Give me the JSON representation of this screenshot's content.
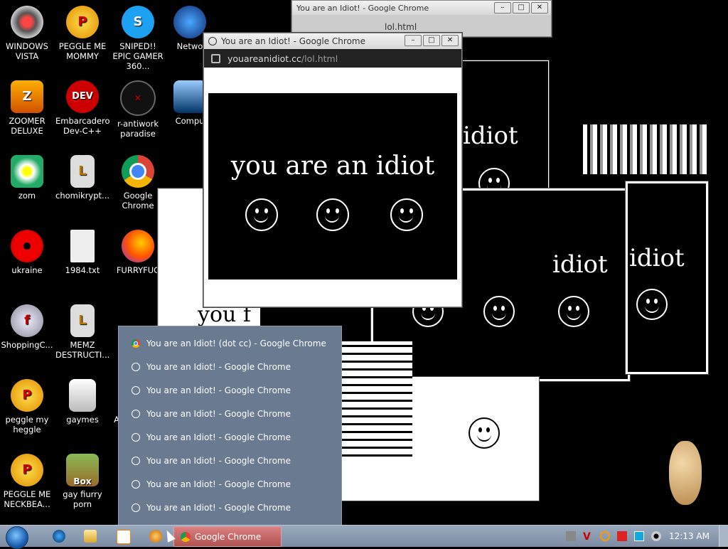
{
  "desktop_icons": [
    {
      "label": "WINDOWS VISTA",
      "icon": "vista-icon"
    },
    {
      "label": "PEGGLE ME MOMMY",
      "icon": "peggle-icon"
    },
    {
      "label": "SNIPED!! EPIC GAMER 360...",
      "icon": "skype-icon"
    },
    {
      "label": "Netwo",
      "icon": "network-icon"
    },
    {
      "label": "ZOOMER DELUXE",
      "icon": "zoomer-icon"
    },
    {
      "label": "Embarcadero Dev-C++",
      "icon": "devcpp-icon"
    },
    {
      "label": "r-antiwork paradise",
      "icon": "antiwork-icon"
    },
    {
      "label": "Compu",
      "icon": "computer-icon"
    },
    {
      "label": "zom",
      "icon": "flower-icon"
    },
    {
      "label": "chomikrypt...",
      "icon": "shortcut-icon"
    },
    {
      "label": "Google Chrome",
      "icon": "chrome-icon"
    },
    {
      "label": "ukraine",
      "icon": "radiation-icon"
    },
    {
      "label": "1984.txt",
      "icon": "text-file-icon"
    },
    {
      "label": "FURRYFUC",
      "icon": "firefox-icon"
    },
    {
      "label": "ShoppingC...",
      "icon": "flash-icon"
    },
    {
      "label": "MEMZ DESTRUCTI...",
      "icon": "shortcut-icon"
    },
    {
      "label": "peggle my heggle",
      "icon": "peggle-icon"
    },
    {
      "label": "gaymes",
      "icon": "folder-icon"
    },
    {
      "label": "A",
      "icon": "generic-icon"
    },
    {
      "label": "PEGGLE ME NECKBEA...",
      "icon": "peggle-icon"
    },
    {
      "label": "gay fiurry porn",
      "icon": "box-icon"
    }
  ],
  "main_window": {
    "title": "You are an Idiot! - Google Chrome",
    "url_host": "youareanidiot.cc",
    "url_path": "/lol.html",
    "message": "you are an idiot"
  },
  "back_windows": {
    "title_1": "You are an Idiot! - Google Chrome",
    "url_fragment": "lol.html",
    "message_fragment": "idiot",
    "message_fragment_2": "you f"
  },
  "jump_list": {
    "items": [
      {
        "label": "You are an Idiot! (dot cc) - Google Chrome",
        "icon": "chrome-icon"
      },
      {
        "label": "You are an Idiot! - Google Chrome",
        "icon": "smiley-icon"
      },
      {
        "label": "You are an Idiot! - Google Chrome",
        "icon": "smiley-icon"
      },
      {
        "label": "You are an Idiot! - Google Chrome",
        "icon": "smiley-icon"
      },
      {
        "label": "You are an Idiot! - Google Chrome",
        "icon": "smiley-icon"
      },
      {
        "label": "You are an Idiot! - Google Chrome",
        "icon": "smiley-icon"
      },
      {
        "label": "You are an Idiot! - Google Chrome",
        "icon": "smiley-icon"
      },
      {
        "label": "You are an Idiot! - Google Chrome",
        "icon": "smiley-icon"
      }
    ]
  },
  "taskbar": {
    "active_task": "Google Chrome",
    "clock": "12:13 AM",
    "box_label": "Box"
  },
  "colors": {
    "taskbar": "#8a9ab0",
    "popup": "#6a7a90",
    "active_task": "#c06262"
  }
}
